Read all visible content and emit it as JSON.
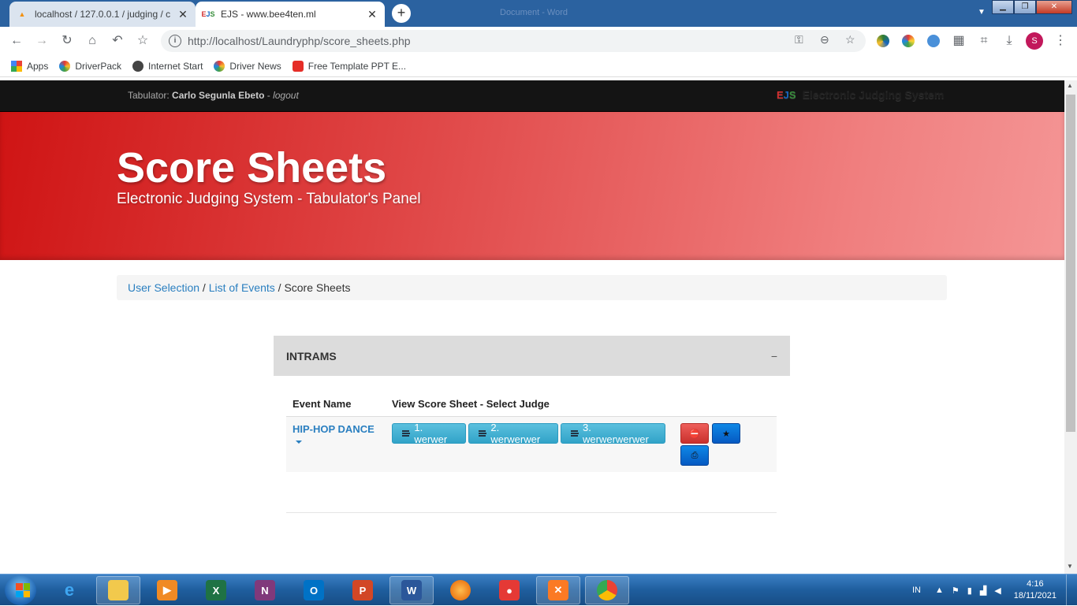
{
  "browser": {
    "tabs": [
      {
        "title": "localhost / 127.0.0.1 / judging / c",
        "favicon": "pma",
        "active": false
      },
      {
        "title": "EJS - www.bee4ten.ml",
        "favicon": "EJS",
        "active": true
      }
    ],
    "window_title": "Document - Word",
    "url": "http://localhost/Laundryphp/score_sheets.php",
    "profile_initial": "S",
    "bookmarks": [
      "Apps",
      "DriverPack",
      "Internet Start",
      "Driver News",
      "Free Template PPT E..."
    ]
  },
  "navbar": {
    "user_prefix": "Tabulator:",
    "user_name": "Carlo Segunla Ebeto",
    "dash": " - ",
    "logout": "logout",
    "brand_logo": "EJS",
    "brand_text": "Electronic Judging System"
  },
  "hero": {
    "title": "Score Sheets",
    "subtitle": "Electronic Judging System - Tabulator's Panel"
  },
  "breadcrumb": {
    "items": [
      "User Selection",
      "List of Events"
    ],
    "sep": " / ",
    "current": "Score Sheets"
  },
  "panel": {
    "title": "INTRAMS",
    "collapse": "−",
    "columns": [
      "Event Name",
      "View Score Sheet - Select Judge"
    ],
    "rows": [
      {
        "event": "HIP-HOP DANCE",
        "judges": [
          "1. werwer",
          "2. werwerwer",
          "3. werwerwerwer"
        ]
      }
    ]
  },
  "taskbar": {
    "lang": "IN",
    "time": "4:16",
    "date": "18/11/2021"
  },
  "colors": {
    "hero_start": "#cf1414",
    "hero_end": "#f49595",
    "link": "#2a7fc0",
    "judge_button": "#5bc0de",
    "action_red": "#d9534f",
    "action_blue": "#0a6fd6"
  }
}
